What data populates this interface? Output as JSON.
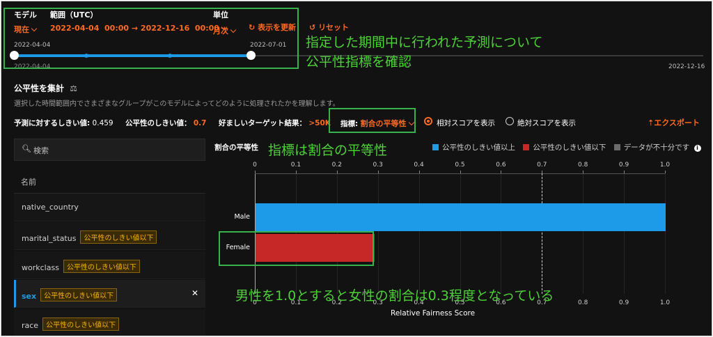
{
  "header": {
    "model_label": "モデル",
    "model_value": "現在",
    "range_label": "範囲（UTC）",
    "range_value": "2022-04-04  00:00 → 2022-12-16  00:00",
    "unit_label": "単位",
    "unit_value": "月次",
    "refresh_label": "表示を更新",
    "reset_label": "リセット"
  },
  "timeline": {
    "start_top": "2022-04-04",
    "end_top": "2022-07-01",
    "start_bottom": "2022-04-04",
    "end_bottom": "2022-12-16"
  },
  "annotations": {
    "a1_line1": "指定した期間中に行われた予測について",
    "a1_line2": "公平性指標を確認",
    "a2": "指標は割合の平等性",
    "a3": "男性を1.0とすると女性の割合は0.3程度となっている"
  },
  "section": {
    "title": "公平性を集計",
    "description": "選択した時間範囲内でさまざまなグループがこのモデルによってどのように処理されたかを理解します。"
  },
  "controls": {
    "pred_threshold_label": "予測に対するしきい値:",
    "pred_threshold_value": "0.459",
    "fair_threshold_label": "公平性のしきい値：",
    "fair_threshold_value": "0.7",
    "target_label": "好ましいターゲット結果：",
    "target_value": ">50K",
    "metric_label": "指標:",
    "metric_value": "割合の平等性",
    "radio_relative": "相対スコアを表示",
    "radio_absolute": "絶対スコアを表示",
    "export_label": "エクスポート"
  },
  "sidebar": {
    "search_placeholder": "検索",
    "column_header": "名前",
    "items": [
      {
        "name": "native_country",
        "badge": ""
      },
      {
        "name": "marital_status",
        "badge": "公平性のしきい値以下"
      },
      {
        "name": "workclass",
        "badge": "公平性のしきい値以下"
      },
      {
        "name": "sex",
        "badge": "公平性のしきい値以下",
        "selected": true
      },
      {
        "name": "race",
        "badge": "公平性のしきい値以下"
      }
    ]
  },
  "colors": {
    "above": "#1e9be8",
    "below": "#c62828",
    "insufficient": "#6b6b6b",
    "accent": "#ff6a21"
  },
  "chart_data": {
    "type": "bar",
    "orientation": "horizontal",
    "title": "割合の平等性",
    "categories": [
      "Male",
      "Female"
    ],
    "values": [
      1.0,
      0.29
    ],
    "bar_status": [
      "above",
      "below"
    ],
    "xlabel": "Relative Fairness Score",
    "xlim": [
      0,
      1.0
    ],
    "ticks": [
      "0",
      "0.1",
      "0.2",
      "0.3",
      "0.4",
      "0.5",
      "0.6",
      "0.7",
      "0.8",
      "0.9",
      "1.0"
    ],
    "threshold": 0.7,
    "legend": [
      "公平性のしきい値以上",
      "公平性のしきい値以下",
      "データが不十分です"
    ],
    "legend_placement": "top-right"
  }
}
